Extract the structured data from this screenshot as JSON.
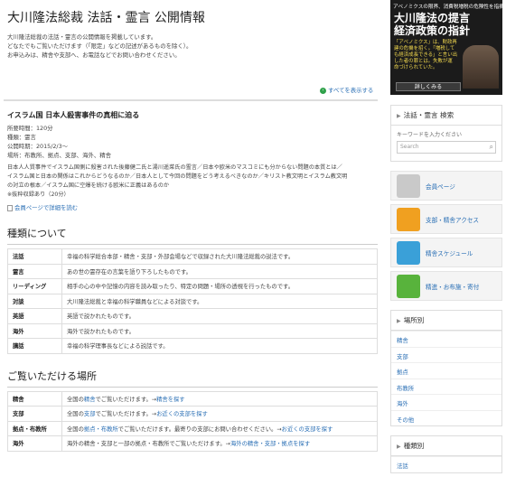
{
  "header": {
    "title": "大川隆法総裁 法話・霊言 公開情報",
    "intro": [
      "大川隆法総裁の法話・霊言の公開情報を掲載しています。",
      "どなたでもご覧いただけます（「限定」などの記述があるものを除く）。",
      "お申込みは、精舎や支部へ、お電話などでお問い合わせください。"
    ],
    "see_all": "すべてを表示する"
  },
  "banner": {
    "top": "アベノミクスの限界、消費税増税の危険性を指摘",
    "title_line1": "大川隆法の提言",
    "title_line2": "経済政策の指針",
    "text": "「アベノミクス」は、財政再建の危機を招く。「増税しても経済成長できる」と言い出した者の罪とは。失敗が運命づけられていた。",
    "more": "詳しくみる"
  },
  "event": {
    "title": "イスラム国 日本人殺害事件の真相に迫る",
    "meta": [
      "所要時間：120分",
      "種類：霊言",
      "公開時期：2015/2/3～",
      "場所：布教所、拠点、支部、海外、精舎"
    ],
    "description": [
      "日本人人質事件でイスラム国側に殺害された後藤健二氏と湯川遥菜氏の霊言／日本や欧米のマスコミにも分からない問題の本質とは／",
      "イスラム国と日本の関係はこれからどうなるのか／日本人として今回の問題をどう考えるべきなのか／キリスト教文明とイスラム教文明",
      "の対立の根本／イスラム国に空爆を続ける欧米に正義はあるのか"
    ],
    "note": "※抜粋収録あり（20分）",
    "member_link": "会員ページで詳細を読む"
  },
  "types": {
    "heading": "種類について",
    "rows": [
      {
        "key": "法話",
        "value": "幸福の科学総合本部・精舎・支部・外部会場などで収録された大川隆法総裁の説法です。"
      },
      {
        "key": "霊言",
        "value": "あの世の霊存在の言葉を語り下ろしたものです。"
      },
      {
        "key": "リーディング",
        "value": "相手の心の中や記憶の内容を読み取ったり、特定の問題・場所の透視を行ったものです。"
      },
      {
        "key": "対談",
        "value": "大川隆法総裁と幸福の科学職員などによる対談です。"
      },
      {
        "key": "英語",
        "value": "英語で説かれたものです。"
      },
      {
        "key": "海外",
        "value": "海外で説かれたものです。"
      },
      {
        "key": "講話",
        "value": "幸福の科学理事長などによる説話です。"
      }
    ]
  },
  "places": {
    "heading": "ご覧いただける場所",
    "rows": [
      {
        "key": "精舎",
        "text": "全国の",
        "link1": "精舎",
        "text2": "でご覧いただけます。→",
        "link2": "精舎を探す"
      },
      {
        "key": "支部",
        "text": "全国の",
        "link1": "支部",
        "text2": "でご覧いただけます。→",
        "link2": "お近くの支部を探す"
      },
      {
        "key": "拠点・布教所",
        "text": "全国の",
        "link1": "拠点・布教所",
        "text2": "でご覧いただけます。最寄りの支部にお問い合わせください。→",
        "link2": "お近くの支部を探す"
      },
      {
        "key": "海外",
        "text": "海外の精舎・支部と一部の拠点・布教所でご覧いただけます。→",
        "link1": "",
        "text2": "",
        "link2": "海外の精舎・支部・拠点を探す"
      }
    ]
  },
  "sidebar": {
    "search_heading": "法話・霊言 検索",
    "keyword_label": "キーワードを入力ください",
    "search_placeholder": "Search",
    "nav": [
      {
        "label": "会員ページ",
        "color": "#c9c9c9"
      },
      {
        "label": "支部・精舎アクセス",
        "color": "#f0a020"
      },
      {
        "label": "精舎スケジュール",
        "color": "#3aa0d8"
      },
      {
        "label": "精進・お布施・寄付",
        "color": "#58b33c"
      }
    ],
    "location_heading": "場所別",
    "locations": [
      "精舎",
      "支部",
      "拠点",
      "布教所",
      "海外",
      "その他"
    ],
    "type_heading": "種類別",
    "type_items": [
      "法話"
    ]
  }
}
